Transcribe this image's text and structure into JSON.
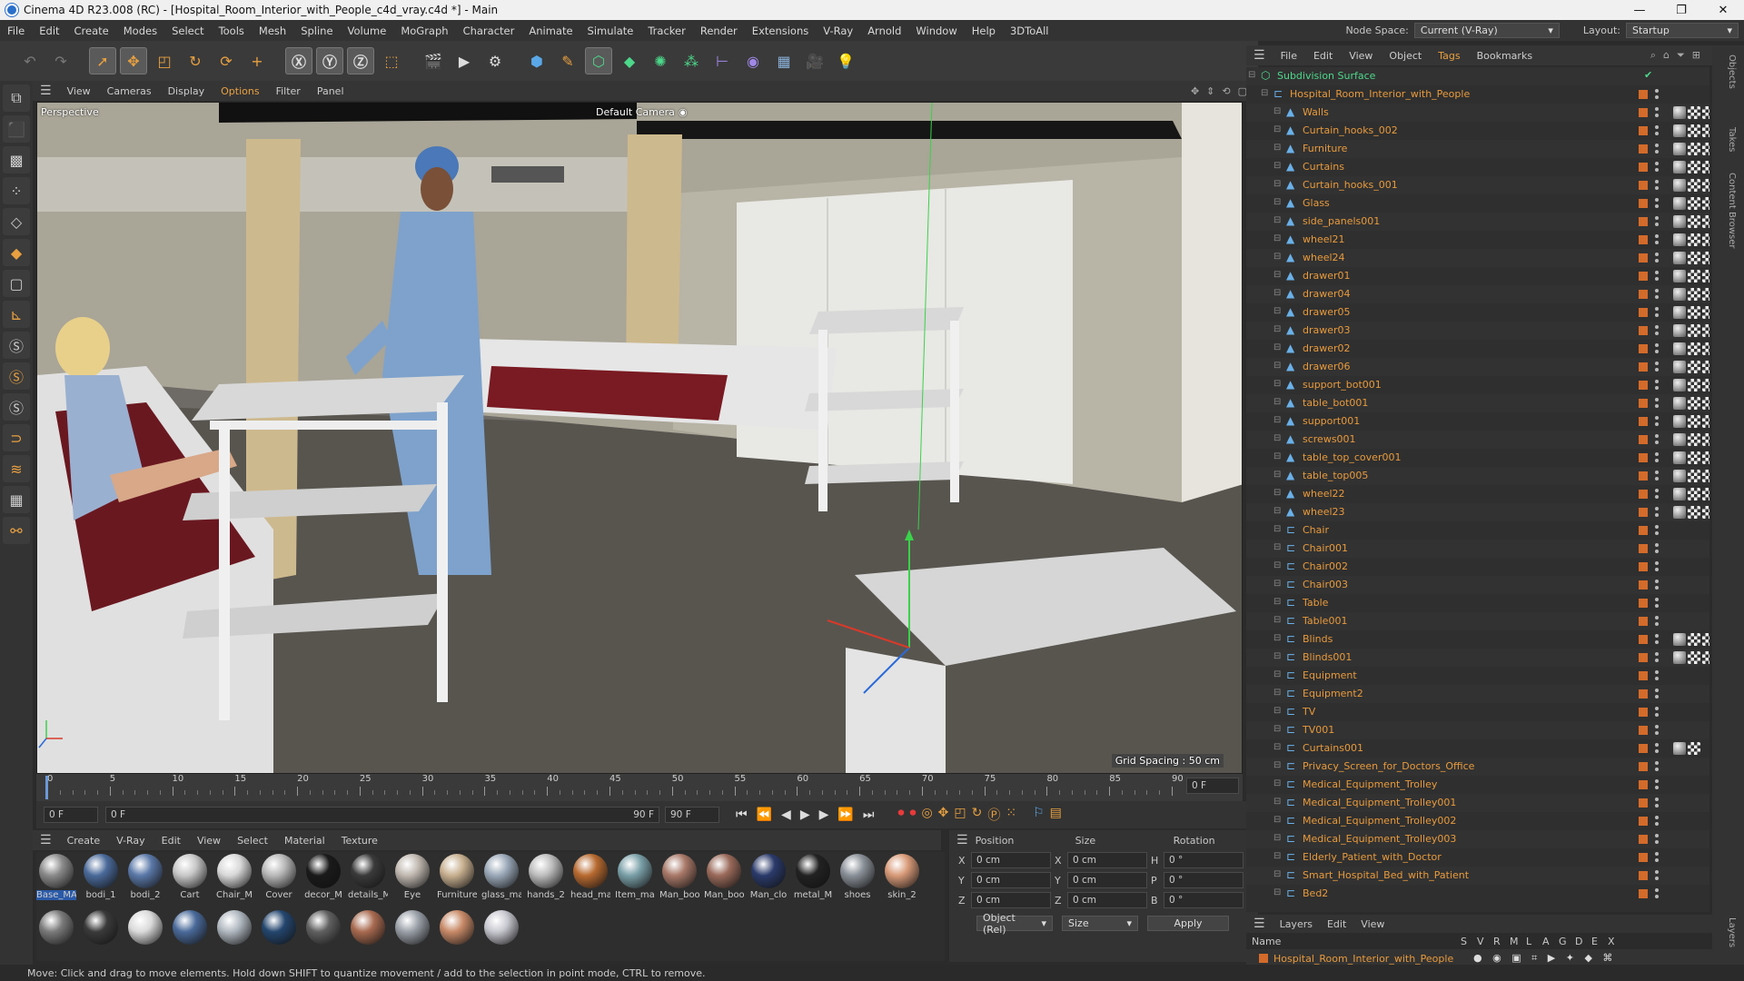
{
  "window": {
    "title": "Cinema 4D R23.008 (RC) - [Hospital_Room_Interior_with_People_c4d_vray.c4d *] - Main",
    "controls": [
      "—",
      "❐",
      "✕"
    ]
  },
  "menu": {
    "items": [
      "File",
      "Edit",
      "Create",
      "Modes",
      "Select",
      "Tools",
      "Mesh",
      "Spline",
      "Volume",
      "MoGraph",
      "Character",
      "Animate",
      "Simulate",
      "Tracker",
      "Render",
      "Extensions",
      "V-Ray",
      "Arnold",
      "Window",
      "Help",
      "3DToAll"
    ],
    "node_space_label": "Node Space:",
    "node_space_value": "Current (V-Ray)",
    "layout_label": "Layout:",
    "layout_value": "Startup"
  },
  "toolbar": {
    "icons": [
      "undo-icon",
      "redo-icon",
      "live-select-icon",
      "move-icon",
      "scale-icon",
      "rotate-icon",
      "recent-tools-icon",
      "add-icon",
      "x-axis-icon",
      "y-axis-icon",
      "z-axis-icon",
      "coordinate-system-icon",
      "render-view-icon",
      "render-picture-viewer-icon",
      "render-settings-icon",
      "cube-icon",
      "pen-icon",
      "subdivision-icon",
      "extrude-icon",
      "cloner-icon",
      "array-icon",
      "deformer-icon",
      "field-icon",
      "floor-icon",
      "camera-icon",
      "light-icon"
    ]
  },
  "viewport": {
    "menus": [
      "View",
      "Cameras",
      "Display",
      "Options",
      "Filter",
      "Panel"
    ],
    "view_name": "Perspective",
    "camera_label": "Default Camera",
    "grid_spacing": "Grid Spacing : 50 cm"
  },
  "timeline": {
    "ticks": [
      "0",
      "5",
      "10",
      "15",
      "20",
      "25",
      "30",
      "35",
      "40",
      "45",
      "50",
      "55",
      "60",
      "65",
      "70",
      "75",
      "80",
      "85",
      "90"
    ],
    "current_frame": "0 F",
    "start_frame": "0 F",
    "current_field": "0 F",
    "end_frame_a": "90 F",
    "end_frame_b": "90 F",
    "right_field": "0 F"
  },
  "materials": {
    "menus": [
      "Create",
      "V-Ray",
      "Edit",
      "View",
      "Select",
      "Material",
      "Texture"
    ],
    "row1": [
      {
        "name": "Base_MA",
        "color": "#8a8a8a"
      },
      {
        "name": "bodi_1",
        "color": "#4a6a9a"
      },
      {
        "name": "bodi_2",
        "color": "#5a78a8"
      },
      {
        "name": "Cart",
        "color": "#c8c8c8"
      },
      {
        "name": "Chair_M",
        "color": "#d8d8d8"
      },
      {
        "name": "Cover",
        "color": "#b8b8b8"
      },
      {
        "name": "decor_M",
        "color": "#1a1a1a"
      },
      {
        "name": "details_M",
        "color": "#3a3a3a"
      },
      {
        "name": "Eye",
        "color": "#c0b8b0"
      },
      {
        "name": "Furniture",
        "color": "#c8b090"
      },
      {
        "name": "glass_ma",
        "color": "#9aa8b8"
      },
      {
        "name": "hands_2",
        "color": "#bdbdbd"
      },
      {
        "name": "head_ma",
        "color": "#b86a30"
      },
      {
        "name": "Item_ma",
        "color": "#7aa0a8"
      },
      {
        "name": "Man_boo",
        "color": "#a87868"
      },
      {
        "name": "Man_boo",
        "color": "#9a6a5a"
      },
      {
        "name": "Man_clo",
        "color": "#2a3a6a"
      },
      {
        "name": "metal_M",
        "color": "#222222"
      },
      {
        "name": "shoes",
        "color": "#8a9098"
      },
      {
        "name": "skin_2",
        "color": "#d89a78"
      }
    ],
    "row2": [
      {
        "color": "#7a7a7a"
      },
      {
        "color": "#3a3a3a"
      },
      {
        "color": "#dadada"
      },
      {
        "color": "#4a6a9a"
      },
      {
        "color": "#b0b8c0"
      },
      {
        "color": "#24466e"
      },
      {
        "color": "#606060"
      },
      {
        "color": "#a86a50"
      },
      {
        "color": "#9aa0a8"
      },
      {
        "color": "#c88a68"
      },
      {
        "color": "#c8c8d0"
      }
    ]
  },
  "coords": {
    "headers": [
      "Position",
      "Size",
      "Rotation"
    ],
    "rows": [
      {
        "axis": "X",
        "pos": "0 cm",
        "saxis": "X",
        "size": "0 cm",
        "raxis": "H",
        "rot": "0 °"
      },
      {
        "axis": "Y",
        "pos": "0 cm",
        "saxis": "Y",
        "size": "0 cm",
        "raxis": "P",
        "rot": "0 °"
      },
      {
        "axis": "Z",
        "pos": "0 cm",
        "saxis": "Z",
        "size": "0 cm",
        "raxis": "B",
        "rot": "0 °"
      }
    ],
    "mode": "Object (Rel)",
    "size_mode": "Size",
    "apply": "Apply"
  },
  "objects": {
    "menus": [
      "File",
      "Edit",
      "View",
      "Object",
      "Tags",
      "Bookmarks"
    ],
    "root": "Subdivision Surface",
    "group": "Hospital_Room_Interior_with_People",
    "children": [
      {
        "name": "Walls",
        "tags": 3
      },
      {
        "name": "Curtain_hooks_002",
        "tags": 3
      },
      {
        "name": "Furniture",
        "tags": 3
      },
      {
        "name": "Curtains",
        "tags": 3
      },
      {
        "name": "Curtain_hooks_001",
        "tags": 3
      },
      {
        "name": "Glass",
        "tags": 3
      },
      {
        "name": "side_panels001",
        "tags": 3
      },
      {
        "name": "wheel21",
        "tags": 3
      },
      {
        "name": "wheel24",
        "tags": 3
      },
      {
        "name": "drawer01",
        "tags": 3
      },
      {
        "name": "drawer04",
        "tags": 3
      },
      {
        "name": "drawer05",
        "tags": 3
      },
      {
        "name": "drawer03",
        "tags": 3
      },
      {
        "name": "drawer02",
        "tags": 3
      },
      {
        "name": "drawer06",
        "tags": 3
      },
      {
        "name": "support_bot001",
        "tags": 3
      },
      {
        "name": "table_bot001",
        "tags": 3
      },
      {
        "name": "support001",
        "tags": 3
      },
      {
        "name": "screws001",
        "tags": 3
      },
      {
        "name": "table_top_cover001",
        "tags": 3
      },
      {
        "name": "table_top005",
        "tags": 3
      },
      {
        "name": "wheel22",
        "tags": 3
      },
      {
        "name": "wheel23",
        "tags": 3
      },
      {
        "name": "Chair",
        "tags": 0
      },
      {
        "name": "Chair001",
        "tags": 0
      },
      {
        "name": "Chair002",
        "tags": 0
      },
      {
        "name": "Chair003",
        "tags": 0
      },
      {
        "name": "Table",
        "tags": 0
      },
      {
        "name": "Table001",
        "tags": 0
      },
      {
        "name": "Blinds",
        "tags": 4
      },
      {
        "name": "Blinds001",
        "tags": 4
      },
      {
        "name": "Equipment",
        "tags": 0
      },
      {
        "name": "Equipment2",
        "tags": 0
      },
      {
        "name": "TV",
        "tags": 0
      },
      {
        "name": "TV001",
        "tags": 0
      },
      {
        "name": "Curtains001",
        "tags": 2
      },
      {
        "name": "Privacy_Screen_for_Doctors_Office",
        "tags": 0
      },
      {
        "name": "Medical_Equipment_Trolley",
        "tags": 0
      },
      {
        "name": "Medical_Equipment_Trolley001",
        "tags": 0
      },
      {
        "name": "Medical_Equipment_Trolley002",
        "tags": 0
      },
      {
        "name": "Medical_Equipment_Trolley003",
        "tags": 0
      },
      {
        "name": "Elderly_Patient_with_Doctor",
        "tags": 0
      },
      {
        "name": "Smart_Hospital_Bed_with_Patient",
        "tags": 0
      },
      {
        "name": "Bed2",
        "tags": 0
      }
    ]
  },
  "layers": {
    "menus": [
      "Layers",
      "Edit",
      "View"
    ],
    "col_name": "Name",
    "cols": [
      "S",
      "V",
      "R",
      "M",
      "L",
      "A",
      "G",
      "D",
      "E",
      "X"
    ],
    "item": "Hospital_Room_Interior_with_People"
  },
  "right_tabs": [
    "Objects",
    "Takes",
    "Content Browser",
    "Layers"
  ],
  "status": "Move: Click and drag to move elements. Hold down SHIFT to quantize movement / add to the selection in point mode, CTRL to remove."
}
